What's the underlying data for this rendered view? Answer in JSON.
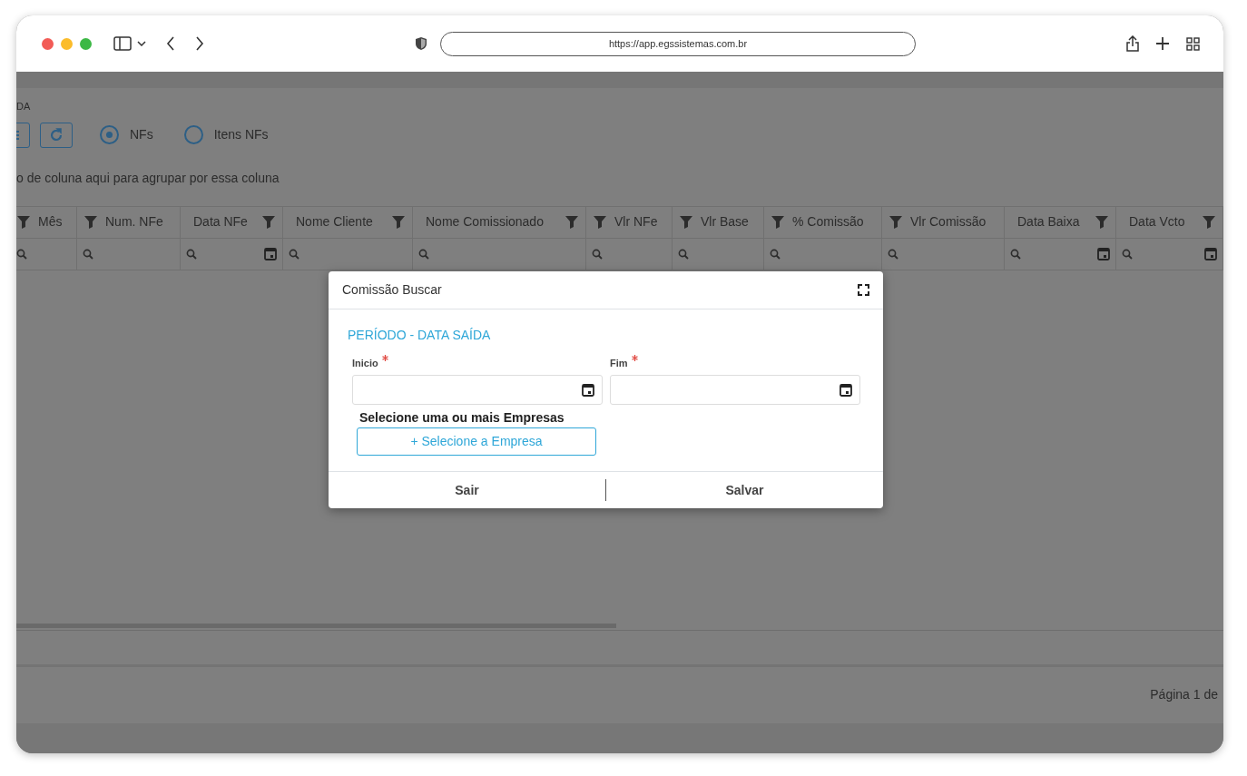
{
  "browser": {
    "url": "https://app.egssistemas.com.br"
  },
  "page": {
    "title": "DA",
    "radios": [
      {
        "label": "NFs",
        "selected": true
      },
      {
        "label": "Itens NFs",
        "selected": false
      }
    ],
    "group_hint": "o de coluna aqui para agrupar por essa coluna",
    "table": {
      "columns": [
        {
          "label": "Mês",
          "filter_right": false,
          "kind": "text"
        },
        {
          "label": "Num. NFe",
          "filter_right": false,
          "kind": "text"
        },
        {
          "label": "Data NFe",
          "filter_right": true,
          "kind": "date"
        },
        {
          "label": "Nome Cliente",
          "filter_right": true,
          "kind": "text"
        },
        {
          "label": "Nome Comissionado",
          "filter_right": true,
          "kind": "text"
        },
        {
          "label": "Vlr NFe",
          "filter_right": false,
          "kind": "text"
        },
        {
          "label": "Vlr Base",
          "filter_right": false,
          "kind": "text"
        },
        {
          "label": "% Comissão",
          "filter_right": false,
          "kind": "text"
        },
        {
          "label": "Vlr Comissão",
          "filter_right": false,
          "kind": "text"
        },
        {
          "label": "Data Baixa",
          "filter_right": true,
          "kind": "date"
        },
        {
          "label": "Data Vcto",
          "filter_right": true,
          "kind": "date"
        }
      ]
    },
    "pager": "Página 1 de"
  },
  "dialog": {
    "title": "Comissão Buscar",
    "section": "PERÍODO - DATA SAÍDA",
    "fields": [
      {
        "label": "Inicio",
        "required": true
      },
      {
        "label": "Fim",
        "required": true
      }
    ],
    "companies_label": "Selecione uma ou mais Empresas",
    "companies_button": "+ Selecione a Empresa",
    "buttons": [
      "Sair",
      "Salvar"
    ]
  }
}
